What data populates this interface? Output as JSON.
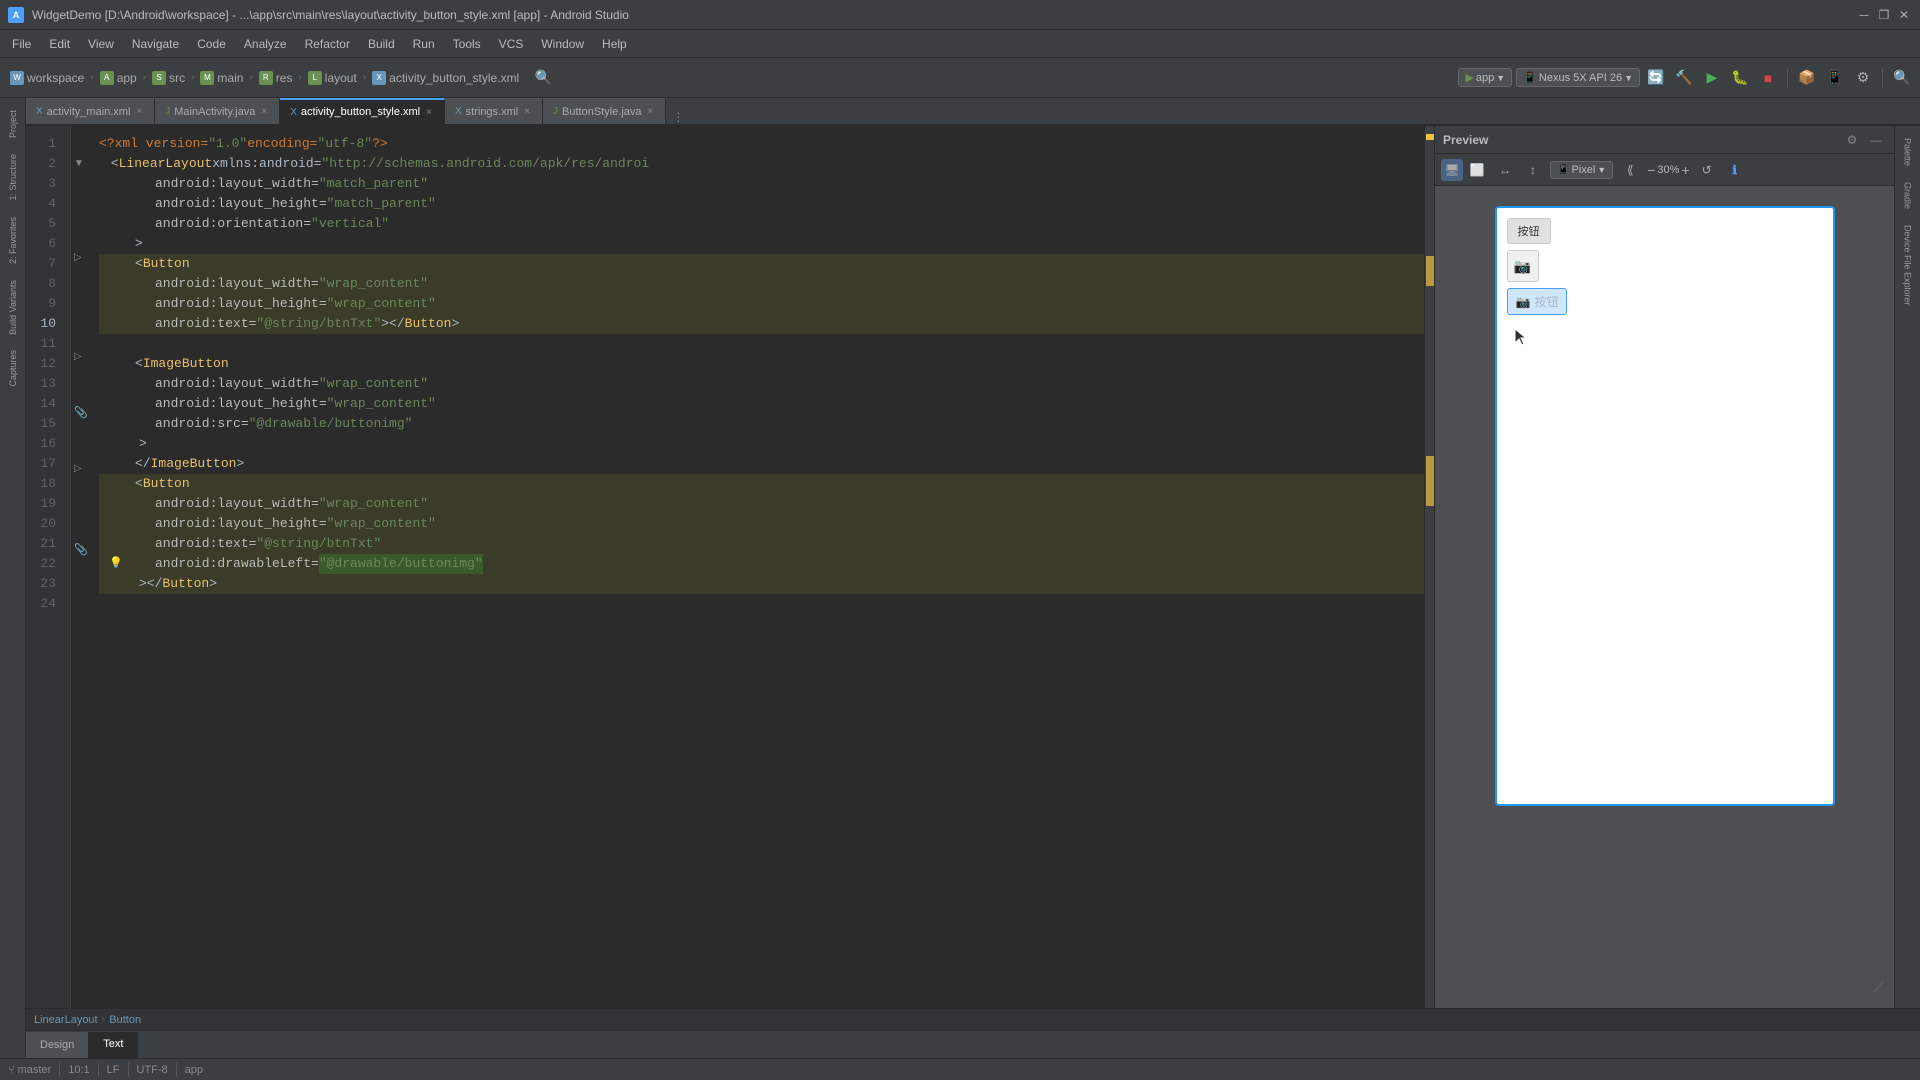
{
  "titlebar": {
    "title": "WidgetDemo [D:\\Android\\workspace] - ...\\app\\src\\main\\res\\layout\\activity_button_style.xml [app] - Android Studio",
    "minimize": "─",
    "maximize": "❐",
    "close": "✕"
  },
  "menubar": {
    "items": [
      "File",
      "Edit",
      "View",
      "Navigate",
      "Code",
      "Analyze",
      "Refactor",
      "Build",
      "Run",
      "Tools",
      "VCS",
      "Window",
      "Help"
    ]
  },
  "toolbar": {
    "breadcrumbs": [
      {
        "label": "workspace",
        "type": "workspace"
      },
      {
        "label": "app",
        "type": "app"
      },
      {
        "label": "src",
        "type": "src"
      },
      {
        "label": "main",
        "type": "main"
      },
      {
        "label": "res",
        "type": "res"
      },
      {
        "label": "layout",
        "type": "layout"
      },
      {
        "label": "activity_button_style.xml",
        "type": "file"
      }
    ],
    "run_config": "app",
    "device": "Nexus 5X API 26"
  },
  "tabs": [
    {
      "label": "activity_main.xml",
      "active": false,
      "modified": false,
      "icon": "xml"
    },
    {
      "label": "MainActivity.java",
      "active": false,
      "modified": false,
      "icon": "java"
    },
    {
      "label": "activity_button_style.xml",
      "active": true,
      "modified": false,
      "icon": "xml"
    },
    {
      "label": "strings.xml",
      "active": false,
      "modified": false,
      "icon": "xml"
    },
    {
      "label": "ButtonStyle.java",
      "active": false,
      "modified": false,
      "icon": "java"
    }
  ],
  "code": {
    "lines": [
      {
        "num": 1,
        "content": "<?xml version=\"1.0\" encoding=\"utf-8\"?>",
        "highlight": false
      },
      {
        "num": 2,
        "content": "  <LinearLayout xmlns:android=\"http://schemas.android.com/apk/res/androi",
        "highlight": false
      },
      {
        "num": 3,
        "content": "        android:layout_width=\"match_parent\"",
        "highlight": false
      },
      {
        "num": 4,
        "content": "        android:layout_height=\"match_parent\"",
        "highlight": false
      },
      {
        "num": 5,
        "content": "        android:orientation=\"vertical\"",
        "highlight": false
      },
      {
        "num": 6,
        "content": "      >",
        "highlight": false
      },
      {
        "num": 7,
        "content": "      <Button",
        "highlight": true
      },
      {
        "num": 8,
        "content": "            android:layout_width=\"wrap_content\"",
        "highlight": true
      },
      {
        "num": 9,
        "content": "            android:layout_height=\"wrap_content\"",
        "highlight": true
      },
      {
        "num": 10,
        "content": "            android:text=\"@string/btnTxt\"></Button>",
        "highlight": true
      },
      {
        "num": 11,
        "content": "",
        "highlight": false
      },
      {
        "num": 12,
        "content": "      <ImageButton",
        "highlight": false
      },
      {
        "num": 13,
        "content": "            android:layout_width=\"wrap_content\"",
        "highlight": false
      },
      {
        "num": 14,
        "content": "            android:layout_height=\"wrap_content\"",
        "highlight": false
      },
      {
        "num": 15,
        "content": "            android:src=\"@drawable/buttonimg\"",
        "highlight": false
      },
      {
        "num": 16,
        "content": "          >",
        "highlight": false
      },
      {
        "num": 17,
        "content": "      </ImageButton>",
        "highlight": false
      },
      {
        "num": 18,
        "content": "      <Button",
        "highlight": true
      },
      {
        "num": 19,
        "content": "            android:layout_width=\"wrap_content\"",
        "highlight": true
      },
      {
        "num": 20,
        "content": "            android:layout_height=\"wrap_content\"",
        "highlight": true
      },
      {
        "num": 21,
        "content": "            android:text=\"@string/btnTxt\"",
        "highlight": true
      },
      {
        "num": 22,
        "content": "            android:drawableLeft=\"@drawable/buttonimg\"",
        "highlight": true
      },
      {
        "num": 23,
        "content": "          ></Button>",
        "highlight": true
      },
      {
        "num": 24,
        "content": "",
        "highlight": false
      }
    ]
  },
  "breadcrumb_path": {
    "items": [
      "LinearLayout",
      "Button"
    ]
  },
  "bottom_tabs": [
    {
      "label": "Design",
      "active": false
    },
    {
      "label": "Text",
      "active": true
    }
  ],
  "preview": {
    "title": "Preview",
    "zoom": "30%",
    "buttons": {
      "button1_label": "按钮",
      "button3_label": "按钮"
    }
  },
  "right_sidebar_tabs": [
    "Palette",
    "Gradle",
    "Device File Explorer"
  ],
  "left_sidebar_tabs": [
    "Project",
    "Structure",
    "Favorites",
    "Build Variants",
    "Captures"
  ],
  "status_bar": {
    "items": [
      "10:1",
      "LF",
      "UTF-8",
      "Git: master"
    ]
  }
}
